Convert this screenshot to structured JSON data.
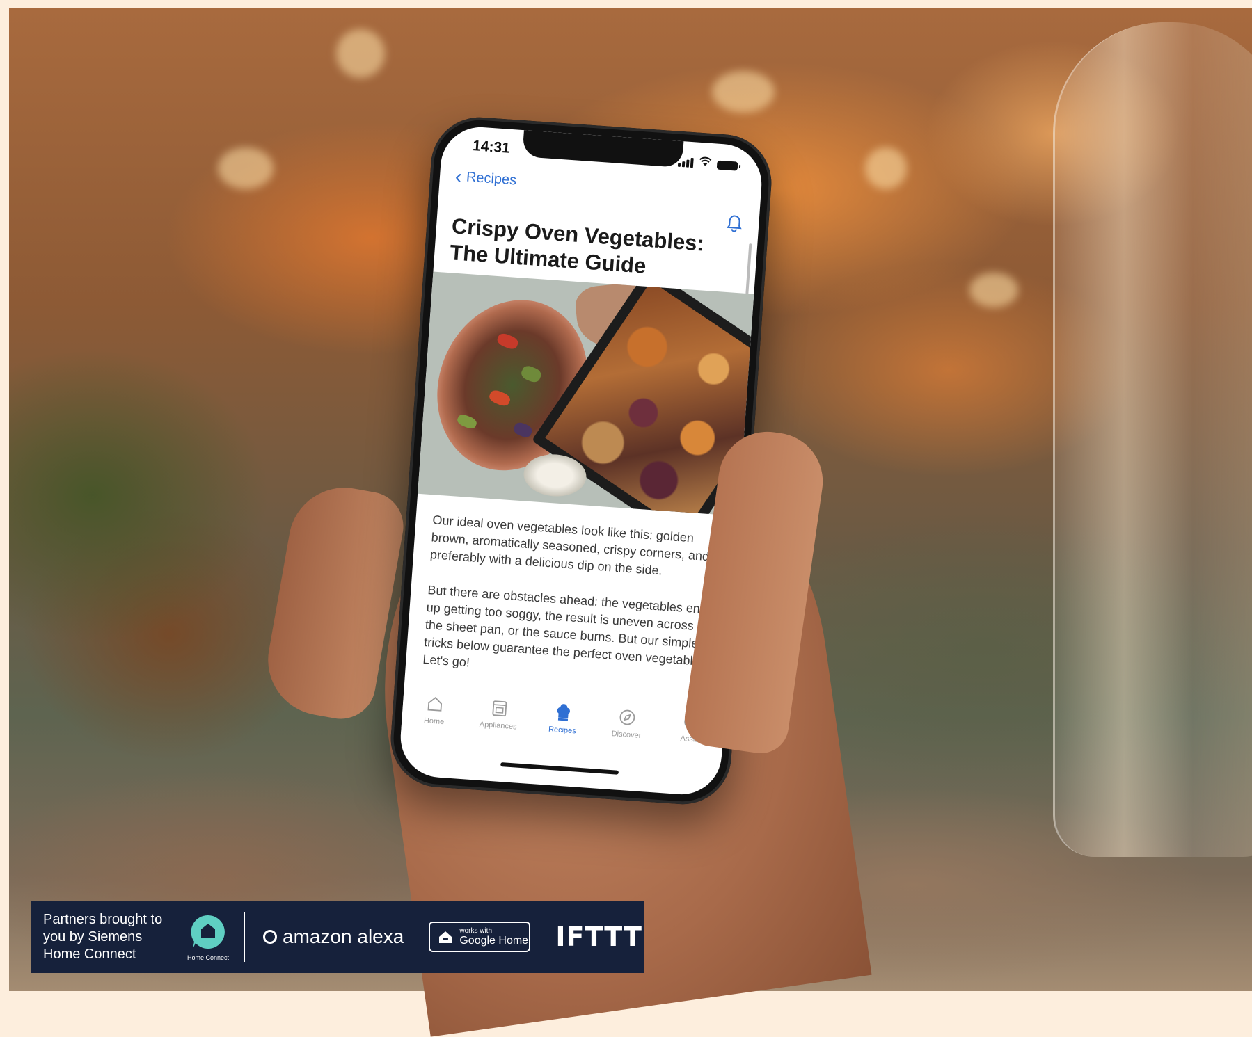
{
  "phone": {
    "status_time": "14:31",
    "nav_back_label": "Recipes",
    "article_title": "Crispy Oven Vegetables: The Ultimate Guide",
    "paragraphs": [
      "Our ideal oven vegetables look like this: golden brown, aromatically seasoned, crispy corners, and preferably with a delicious dip on the side.",
      "But there are obstacles ahead: the vegetables end up getting too soggy, the result is uneven across the sheet pan, or the sauce burns. But our simple tricks below guarantee the perfect oven vegetables. Let's go!"
    ],
    "tabs": [
      {
        "label": "Home",
        "icon": "house-icon"
      },
      {
        "label": "Appliances",
        "icon": "oven-icon"
      },
      {
        "label": "Recipes",
        "icon": "chef-hat-icon",
        "active": true
      },
      {
        "label": "Discover",
        "icon": "compass-icon"
      },
      {
        "label": "Assist",
        "icon": "smiley-icon"
      }
    ],
    "accent_color": "#2f6fd3"
  },
  "banner": {
    "text": "Partners brought to you by Siemens Home Connect",
    "home_connect_label": "Home Connect",
    "alexa_label": "amazon alexa",
    "google_small": "works with",
    "google_big": "Google Home",
    "ifttt_label": "IFTTT",
    "background_color": "#16213b",
    "home_connect_color": "#5fcfc2"
  }
}
